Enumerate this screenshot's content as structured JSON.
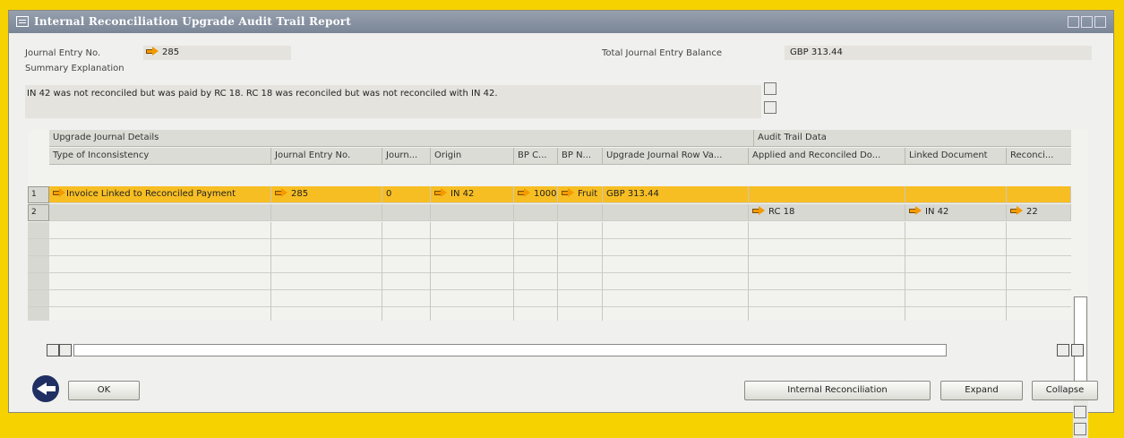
{
  "window": {
    "title": "Internal Reconciliation Upgrade Audit Trail Report"
  },
  "header": {
    "journal_entry_label": "Journal Entry No.",
    "journal_entry_value": "285",
    "total_balance_label": "Total Journal Entry Balance",
    "total_balance_value": "GBP 313.44",
    "summary_label": "Summary Explanation",
    "summary_text": "IN 42 was not reconciled but was paid by RC 18. RC 18 was reconciled but was not reconciled with IN 42."
  },
  "grid": {
    "group_upgrade": "Upgrade Journal Details",
    "group_audit": "Audit Trail Data",
    "columns": [
      "Type of Inconsistency",
      "Journal Entry No.",
      "Journ...",
      "Origin",
      "BP C...",
      "BP N...",
      "Upgrade Journal Row Va...",
      "Applied and Reconciled Do...",
      "Linked Document",
      "Reconci..."
    ],
    "rows": [
      {
        "num": "1",
        "type": "Invoice Linked to Reconciled Payment",
        "je_no": "285",
        "journ": "0",
        "origin": "IN 42",
        "bp_code": "1000",
        "bp_name": "Fruit",
        "upgrade_row_val": "GBP 313.44",
        "applied": "",
        "linked": "",
        "reconci": ""
      },
      {
        "num": "2",
        "type": "",
        "je_no": "",
        "journ": "",
        "origin": "",
        "bp_code": "",
        "bp_name": "",
        "upgrade_row_val": "",
        "applied": "RC 18",
        "linked": "IN 42",
        "reconci": "22"
      }
    ]
  },
  "buttons": {
    "ok": "OK",
    "internal_reconciliation": "Internal Reconciliation",
    "expand": "Expand",
    "collapse": "Collapse"
  },
  "colors": {
    "background": "#f6d200",
    "selected_row": "#f7be23",
    "titlebar": "#7d8898",
    "arrow": "#f29a00"
  }
}
